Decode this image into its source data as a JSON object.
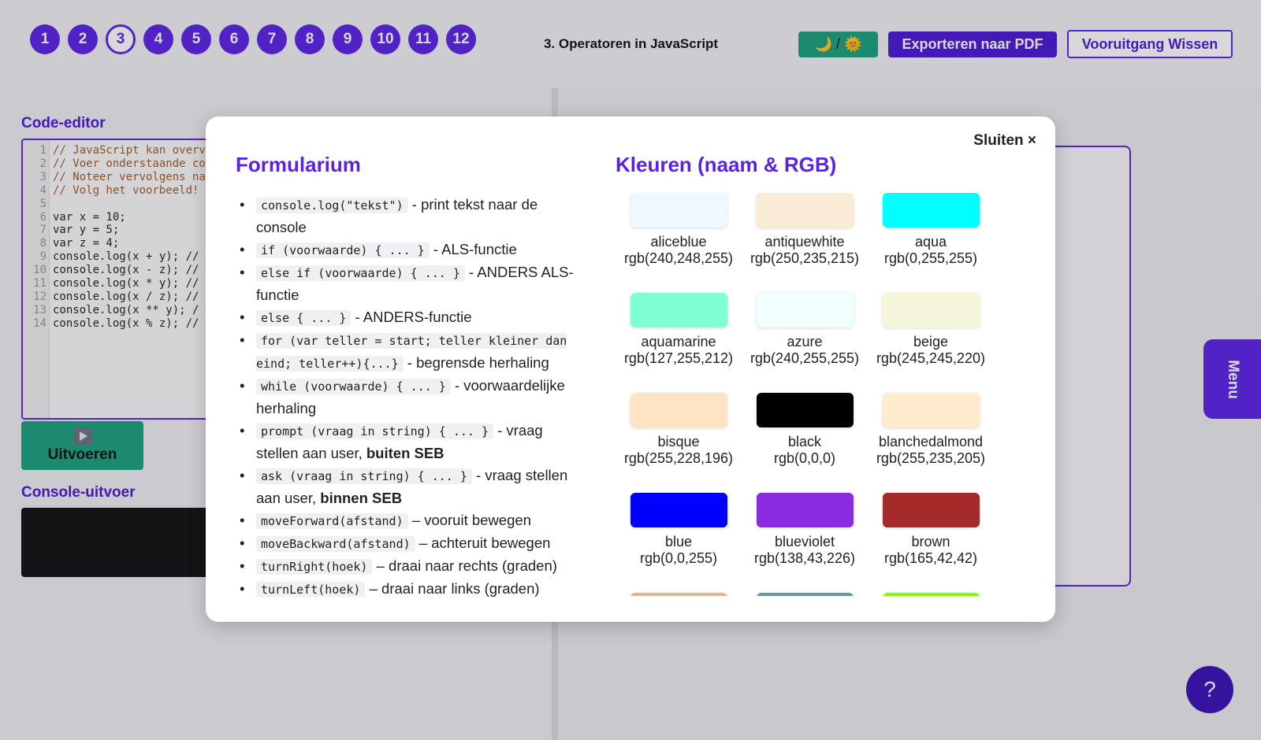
{
  "lesson_nav": [
    "1",
    "2",
    "3",
    "4",
    "5",
    "6",
    "7",
    "8",
    "9",
    "10",
    "11",
    "12"
  ],
  "active_lesson_index": 2,
  "lesson_title": "3. Operatoren in JavaScript",
  "header": {
    "theme_toggle_label": "🌙 / 🌞",
    "export_label": "Exporteren naar PDF",
    "reset_label": "Vooruitgang Wissen"
  },
  "editor": {
    "title": "Code-editor",
    "lines": [
      {
        "no": "1",
        "code": "// JavaScript kan overv",
        "comment": true
      },
      {
        "no": "2",
        "code": "// Voer onderstaande co",
        "comment": true
      },
      {
        "no": "3",
        "code": "// Noteer vervolgens na",
        "comment": true
      },
      {
        "no": "4",
        "code": "// Volg het voorbeeld!",
        "comment": true
      },
      {
        "no": "5",
        "code": "",
        "comment": false
      },
      {
        "no": "6",
        "code": "var x = 10;",
        "comment": false
      },
      {
        "no": "7",
        "code": "var y = 5;",
        "comment": false
      },
      {
        "no": "8",
        "code": "var z = 4;",
        "comment": false
      },
      {
        "no": "9",
        "code": "console.log(x + y); //",
        "comment": false
      },
      {
        "no": "10",
        "code": "console.log(x - z); //",
        "comment": false
      },
      {
        "no": "11",
        "code": "console.log(x * y); //",
        "comment": false
      },
      {
        "no": "12",
        "code": "console.log(x / z); //",
        "comment": false
      },
      {
        "no": "13",
        "code": "console.log(x ** y); /",
        "comment": false
      },
      {
        "no": "14",
        "code": "console.log(x % z); //",
        "comment": false
      }
    ],
    "run_label": "Uitvoeren"
  },
  "console": {
    "title": "Console-uitvoer"
  },
  "menu_label": "Menu",
  "help_label": "?",
  "modal": {
    "close_label": "Sluiten ×",
    "formulas_title": "Formularium",
    "colors_title": "Kleuren (naam & RGB)",
    "formulas": [
      {
        "code": "console.log(\"tekst\")",
        "text": " - print tekst naar de console",
        "bold": ""
      },
      {
        "code": "if (voorwaarde) { ... }",
        "text": " - ALS-functie",
        "bold": ""
      },
      {
        "code": "else if (voorwaarde) { ... }",
        "text": " - ANDERS ALS-functie",
        "bold": ""
      },
      {
        "code": "else { ... }",
        "text": " - ANDERS-functie",
        "bold": ""
      },
      {
        "code": "for (var teller = start; teller kleiner dan eind; teller++){...}",
        "text": " - begrensde herhaling",
        "bold": ""
      },
      {
        "code": "while (voorwaarde) { ... }",
        "text": " - voorwaardelijke herhaling",
        "bold": ""
      },
      {
        "code": "prompt (vraag in string) { ... }",
        "text": " - vraag stellen aan user, ",
        "bold": "buiten SEB"
      },
      {
        "code": "ask (vraag in string) { ... }",
        "text": " - vraag stellen aan user, ",
        "bold": "binnen SEB"
      },
      {
        "code": "moveForward(afstand)",
        "text": " – vooruit bewegen",
        "bold": ""
      },
      {
        "code": "moveBackward(afstand)",
        "text": " – achteruit bewegen",
        "bold": ""
      },
      {
        "code": "turnRight(hoek)",
        "text": " – draai naar rechts (graden)",
        "bold": ""
      },
      {
        "code": "turnLeft(hoek)",
        "text": " – draai naar links (graden)",
        "bold": ""
      }
    ],
    "colors": [
      {
        "name": "aliceblue",
        "rgb": "rgb(240,248,255)",
        "hex": "#f0f8ff"
      },
      {
        "name": "antiquewhite",
        "rgb": "rgb(250,235,215)",
        "hex": "#faebd7"
      },
      {
        "name": "aqua",
        "rgb": "rgb(0,255,255)",
        "hex": "#00ffff"
      },
      {
        "name": "aquamarine",
        "rgb": "rgb(127,255,212)",
        "hex": "#7fffd4"
      },
      {
        "name": "azure",
        "rgb": "rgb(240,255,255)",
        "hex": "#f0ffff"
      },
      {
        "name": "beige",
        "rgb": "rgb(245,245,220)",
        "hex": "#f5f5dc"
      },
      {
        "name": "bisque",
        "rgb": "rgb(255,228,196)",
        "hex": "#ffe4c4"
      },
      {
        "name": "black",
        "rgb": "rgb(0,0,0)",
        "hex": "#000000"
      },
      {
        "name": "blanchedalmond",
        "rgb": "rgb(255,235,205)",
        "hex": "#ffebcd"
      },
      {
        "name": "blue",
        "rgb": "rgb(0,0,255)",
        "hex": "#0000ff"
      },
      {
        "name": "blueviolet",
        "rgb": "rgb(138,43,226)",
        "hex": "#8a2be2"
      },
      {
        "name": "brown",
        "rgb": "rgb(165,42,42)",
        "hex": "#a52a2a"
      }
    ],
    "partial_swatch_colors": [
      "#deb887",
      "#5f9ea0",
      "#7fff00"
    ]
  }
}
